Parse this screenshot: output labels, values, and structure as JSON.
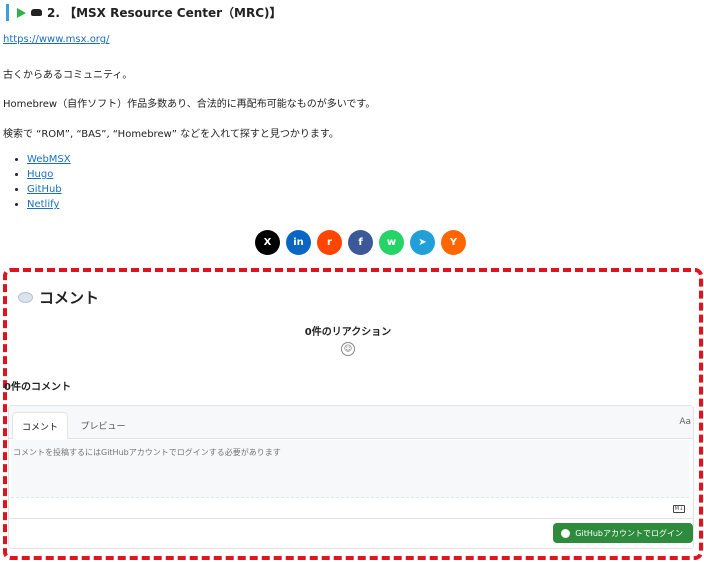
{
  "section": {
    "title": "2. 【MSX Resource Center（MRC)】"
  },
  "body": {
    "url": "https://www.msx.org/",
    "para1": "古くからあるコミュニティ。",
    "para2": "Homebrew（自作ソフト）作品多数あり、合法的に再配布可能なものが多いです。",
    "para3": "検索で “ROM”, “BAS”, “Homebrew” などを入れて探すと見つかります。",
    "links": [
      "WebMSX",
      "Hugo",
      "GitHub",
      "Netlify"
    ]
  },
  "share": [
    {
      "icon": "x-icon",
      "glyph": "X",
      "color": "#000000"
    },
    {
      "icon": "linkedin-icon",
      "glyph": "in",
      "color": "#0a66c2"
    },
    {
      "icon": "reddit-icon",
      "glyph": "r",
      "color": "#ff4500"
    },
    {
      "icon": "facebook-icon",
      "glyph": "f",
      "color": "#3b5998"
    },
    {
      "icon": "whatsapp-icon",
      "glyph": "w",
      "color": "#25d366"
    },
    {
      "icon": "telegram-icon",
      "glyph": "➤",
      "color": "#229ed9"
    },
    {
      "icon": "hackernews-icon",
      "glyph": "Y",
      "color": "#ff6600"
    }
  ],
  "comments": {
    "heading": "コメント",
    "reactions": "0件のリアクション",
    "count": "0件のコメント",
    "tab_write": "コメント",
    "tab_preview": "プレビュー",
    "aa": "Aa",
    "placeholder": "コメントを投稿するにはGitHubアカウントでログインする必要があります",
    "markdown": "M↓",
    "login_button": "GitHubアカウントでログイン"
  },
  "colors": {
    "highlight_border": "#e0141e",
    "login_button": "#2e8b3e",
    "link": "#1a6fc4"
  }
}
